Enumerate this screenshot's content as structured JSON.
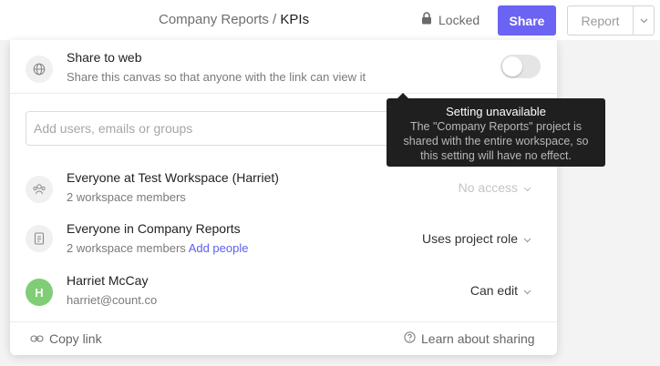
{
  "header": {
    "breadcrumb_parent": "Company Reports",
    "breadcrumb_separator": " / ",
    "breadcrumb_current": "KPIs",
    "locked_label": "Locked",
    "share_label": "Share",
    "report_label": "Report"
  },
  "share_panel": {
    "share_to_web": {
      "title": "Share to web",
      "description": "Share this canvas so that anyone with the link can view it",
      "enabled": false
    },
    "add_people_placeholder": "Add users, emails or groups",
    "members": [
      {
        "name": "Everyone at Test Workspace (Harriet)",
        "detail": "2 workspace members",
        "role": "No access",
        "icon": "users-group-icon"
      },
      {
        "name": "Everyone in Company Reports",
        "detail": "2 workspace members",
        "detail_link": "Add people",
        "role": "Uses project role",
        "icon": "document-icon"
      },
      {
        "name": "Harriet McCay",
        "detail": "harriet@count.co",
        "role": "Can edit",
        "avatar_initial": "H",
        "avatar_color": "#7fcd75"
      }
    ],
    "footer": {
      "copy_link": "Copy link",
      "learn_about_sharing": "Learn about sharing"
    }
  },
  "tooltip": {
    "title": "Setting unavailable",
    "body": "The \"Company Reports\" project is shared with the entire workspace, so this setting will have no effect."
  },
  "colors": {
    "accent": "#6b63f3",
    "link": "#5b5ff0",
    "tooltip_bg": "#1f1f1f"
  }
}
